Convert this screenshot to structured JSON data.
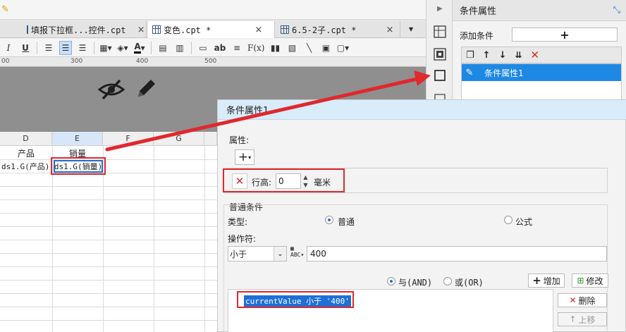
{
  "tabs": [
    {
      "label": "填报下拉框...控件.cpt",
      "close": "×"
    },
    {
      "label": "变色.cpt *",
      "close": "×"
    },
    {
      "label": "6.5-2子.cpt *",
      "close": "×"
    }
  ],
  "toolbar": {
    "italic": "I",
    "underline": "U",
    "text_tool": "ab",
    "formula": "F(x)",
    "font_color_letter": "A"
  },
  "ruler_labels": [
    "00",
    "300",
    "400",
    "500"
  ],
  "sheet": {
    "columns": [
      "D",
      "E",
      "F",
      "G"
    ],
    "header_row": {
      "D": "产品",
      "E": "销量"
    },
    "data_row": {
      "D": "ds1.G(产品)",
      "E": "ds1.G(销量)"
    }
  },
  "right_panel": {
    "title": "条件属性",
    "add_condition_label": "添加条件",
    "add_button": "+",
    "condition_items": [
      "条件属性1"
    ]
  },
  "dialog": {
    "title": "条件属性1",
    "attribute_section": "属性:",
    "add_attr": "+",
    "row_height_label": "行高:",
    "row_height_value": "0",
    "unit": "毫米",
    "normal_condition_section": "普通条件",
    "type_label": "类型:",
    "type_normal": "普通",
    "type_formula": "公式",
    "operator_label": "操作符:",
    "operator_value": "小于",
    "operand_value": "400",
    "and_label": "与(AND)",
    "or_label": "或(OR)",
    "add_btn": "增加",
    "modify_btn": "修改",
    "delete_btn": "删除",
    "up_btn": "上移",
    "condition_expression": "currentValue 小于 '400'"
  },
  "colors": {
    "accent": "#2a7ad6",
    "selection": "#1e70d8",
    "highlight_red": "#e0282d"
  }
}
